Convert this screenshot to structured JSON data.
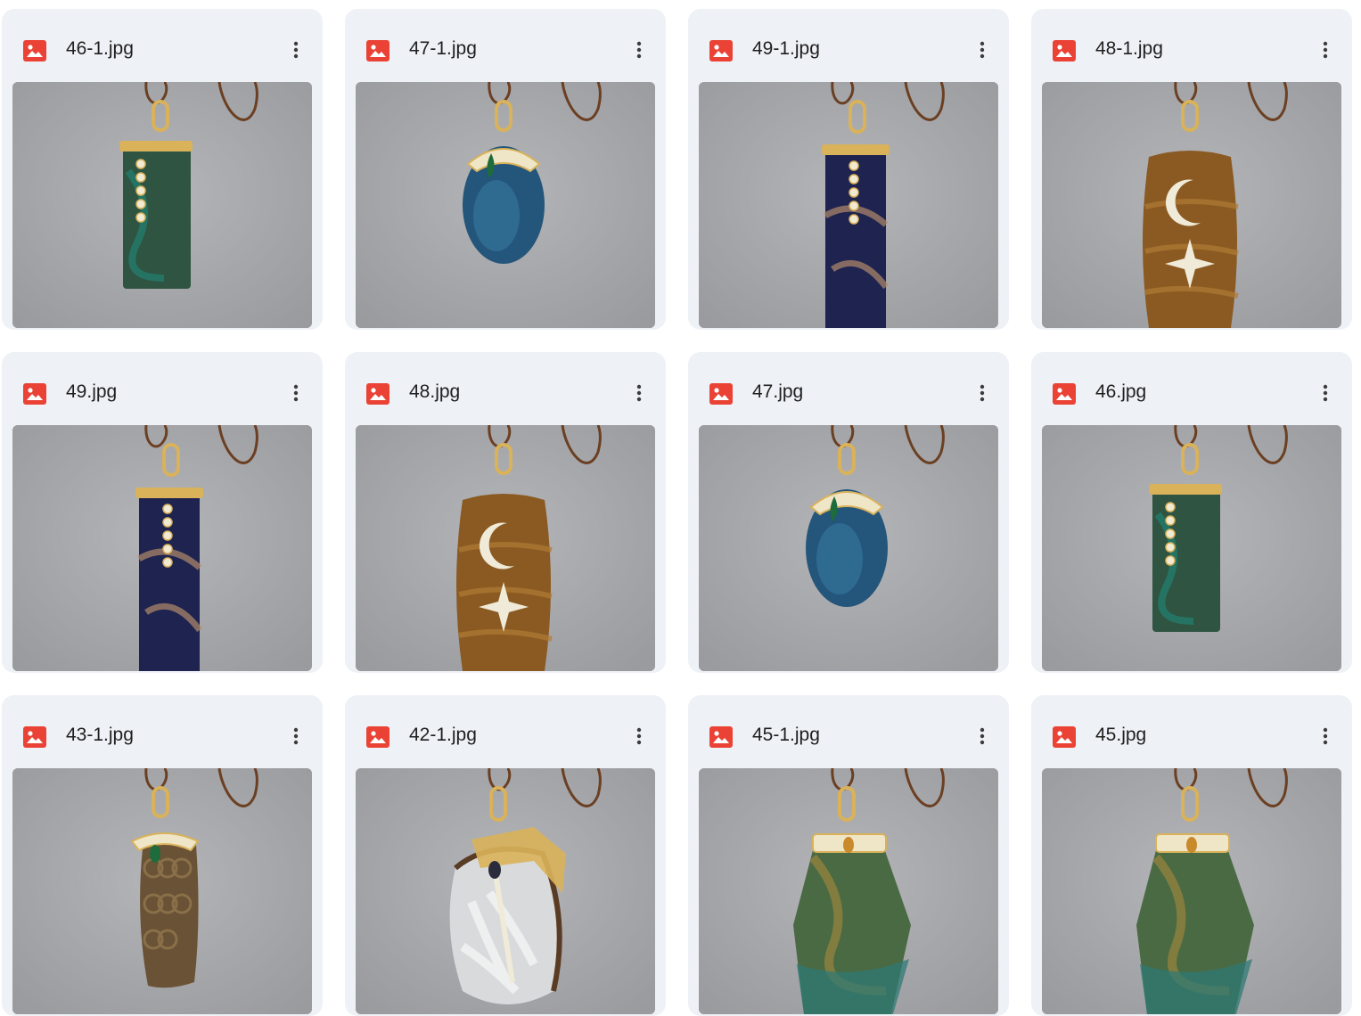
{
  "files": [
    {
      "name": "46-1.jpg",
      "icon": "image-icon",
      "stone": "green-rect",
      "colors": {
        "base": "#2f5442",
        "accent": "#1f8a7a",
        "vein": "#3c6b4a"
      }
    },
    {
      "name": "47-1.jpg",
      "icon": "image-icon",
      "stone": "blue-oval",
      "colors": {
        "base": "#24557a",
        "accent": "#3a7fa8",
        "vein": "#1b3d5c"
      }
    },
    {
      "name": "49-1.jpg",
      "icon": "image-icon",
      "stone": "sodalite-bar",
      "colors": {
        "base": "#1e2350",
        "accent": "#b08a6a",
        "vein": "#2c346c"
      }
    },
    {
      "name": "48-1.jpg",
      "icon": "image-icon",
      "stone": "tigereye-moon",
      "colors": {
        "base": "#8a5a22",
        "accent": "#b07a35",
        "vein": "#5e3a14"
      }
    },
    {
      "name": "49.jpg",
      "icon": "image-icon",
      "stone": "sodalite-bar",
      "colors": {
        "base": "#1e2350",
        "accent": "#b08a6a",
        "vein": "#2c346c"
      }
    },
    {
      "name": "48.jpg",
      "icon": "image-icon",
      "stone": "tigereye-moon",
      "colors": {
        "base": "#8a5a22",
        "accent": "#b07a35",
        "vein": "#5e3a14"
      }
    },
    {
      "name": "47.jpg",
      "icon": "image-icon",
      "stone": "blue-oval",
      "colors": {
        "base": "#24557a",
        "accent": "#3a7fa8",
        "vein": "#1b3d5c"
      }
    },
    {
      "name": "46.jpg",
      "icon": "image-icon",
      "stone": "green-rect",
      "colors": {
        "base": "#2f5442",
        "accent": "#1f8a7a",
        "vein": "#3c6b4a"
      }
    },
    {
      "name": "43-1.jpg",
      "icon": "image-icon",
      "stone": "brown-oval",
      "colors": {
        "base": "#6a5236",
        "accent": "#8a7048",
        "vein": "#4e3a24"
      }
    },
    {
      "name": "42-1.jpg",
      "icon": "image-icon",
      "stone": "agate-slice",
      "colors": {
        "base": "#d8dadc",
        "accent": "#2a2c3c",
        "vein": "#f4f4f4"
      }
    },
    {
      "name": "45-1.jpg",
      "icon": "image-icon",
      "stone": "green-kite",
      "colors": {
        "base": "#4a6a44",
        "accent": "#a88a3a",
        "vein": "#2f7a74"
      }
    },
    {
      "name": "45.jpg",
      "icon": "image-icon",
      "stone": "green-kite",
      "colors": {
        "base": "#4a6a44",
        "accent": "#a88a3a",
        "vein": "#2f7a74"
      }
    }
  ],
  "colors": {
    "card_bg": "#eef1f6",
    "icon_red": "#ea4335",
    "thumb_bg": "#a9aaad",
    "gold": "#d9b25a",
    "cord": "#6b3f22"
  }
}
